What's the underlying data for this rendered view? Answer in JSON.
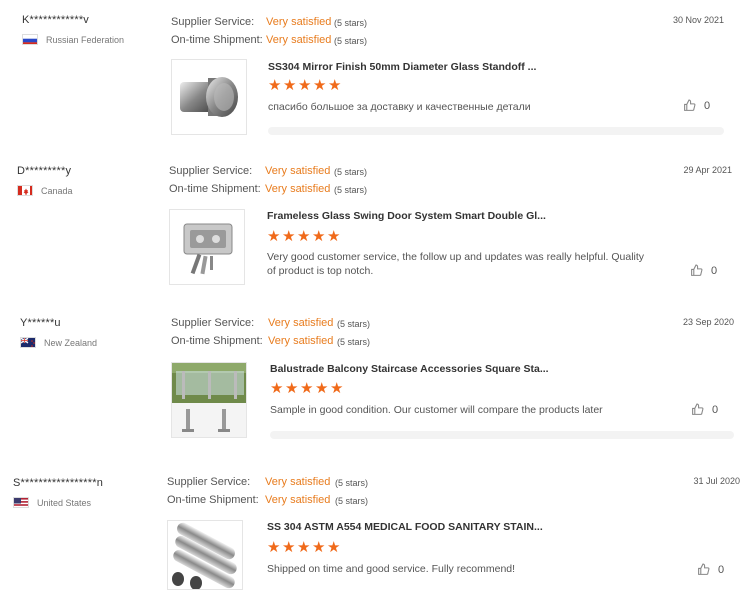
{
  "reviews": [
    {
      "buyer": "K************v",
      "country": "Russian Federation",
      "flag": "ru",
      "date": "30 Nov 2021",
      "supplier_label": "Supplier Service:",
      "supplier_value": "Very satisfied",
      "supplier_stars": "(5 stars)",
      "shipment_label": "On-time Shipment:",
      "shipment_value": "Very satisfied",
      "shipment_stars": "(5 stars)",
      "product": "SS304 Mirror Finish 50mm Diameter Glass Standoff ...",
      "rating": 5,
      "comment": "спасибо большое за доставку и качественные детали",
      "likes": "0"
    },
    {
      "buyer": "D*********y",
      "country": "Canada",
      "flag": "ca",
      "date": "29 Apr 2021",
      "supplier_label": "Supplier Service:",
      "supplier_value": "Very satisfied",
      "supplier_stars": "(5 stars)",
      "shipment_label": "On-time Shipment:",
      "shipment_value": "Very satisfied",
      "shipment_stars": "(5 stars)",
      "product": "Frameless Glass Swing Door System Smart Double Gl...",
      "rating": 5,
      "comment": "Very good customer service, the follow up and updates was really helpful. Quality of product is top notch.",
      "likes": "0"
    },
    {
      "buyer": "Y******u",
      "country": "New Zealand",
      "flag": "nz",
      "date": "23 Sep 2020",
      "supplier_label": "Supplier Service:",
      "supplier_value": "Very satisfied",
      "supplier_stars": "(5 stars)",
      "shipment_label": "On-time Shipment:",
      "shipment_value": "Very satisfied",
      "shipment_stars": "(5 stars)",
      "product": "Balustrade Balcony Staircase Accessories Square Sta...",
      "rating": 5,
      "comment": "Sample in good condition. Our customer will compare the products later",
      "likes": "0"
    },
    {
      "buyer": "S*****************n",
      "country": "United States",
      "flag": "us",
      "date": "31 Jul 2020",
      "supplier_label": "Supplier Service:",
      "supplier_value": "Very satisfied",
      "supplier_stars": "(5 stars)",
      "shipment_label": "On-time Shipment:",
      "shipment_value": "Very satisfied",
      "shipment_stars": "(5 stars)",
      "product": "SS 304 ASTM A554 MEDICAL FOOD SANITARY STAIN...",
      "rating": 5,
      "comment": "Shipped on time and good service. Fully recommend!",
      "likes": "0"
    }
  ],
  "colors": {
    "accent": "#e87c1e",
    "star": "#f06a1a"
  },
  "icons": {
    "star": "star-icon",
    "like": "thumbs-up-icon"
  }
}
